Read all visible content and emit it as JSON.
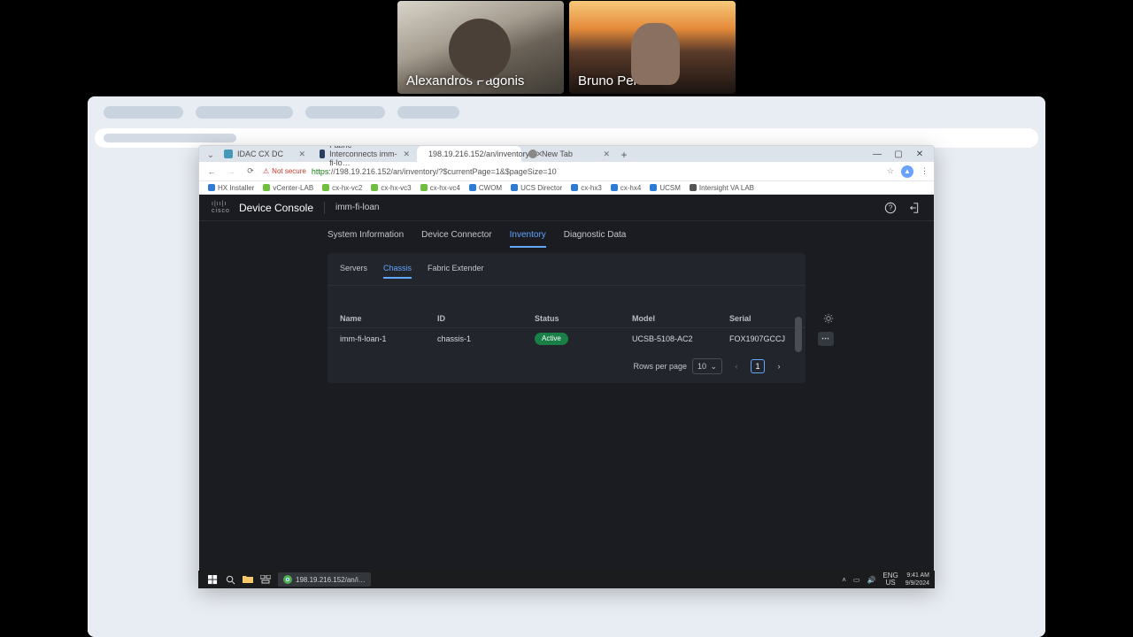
{
  "video": {
    "p1_name": "Alexandros Pagonis",
    "p2_name": "Bruno Pereira"
  },
  "outer_tabs": [
    "",
    "",
    "",
    ""
  ],
  "chrome": {
    "tabs": [
      {
        "label": "IDAC CX DC",
        "active": false
      },
      {
        "label": "Fabric Interconnects imm-fi-lo…",
        "active": false
      },
      {
        "label": "198.19.216.152/an/inventory/",
        "active": true
      },
      {
        "label": "New Tab",
        "active": false
      }
    ],
    "notsecure": "Not secure",
    "url_scheme": "https",
    "url_rest": "://198.19.216.152/an/inventory/?$currentPage=1&$pageSize=10"
  },
  "bookmarks": [
    {
      "c": "#2e7bd6",
      "t": "HX Installer"
    },
    {
      "c": "#6fbf3f",
      "t": "vCenter-LAB"
    },
    {
      "c": "#6fbf3f",
      "t": "cx-hx-vc2"
    },
    {
      "c": "#6fbf3f",
      "t": "cx-hx-vc3"
    },
    {
      "c": "#6fbf3f",
      "t": "cx-hx-vc4"
    },
    {
      "c": "#2e7bd6",
      "t": "CWOM"
    },
    {
      "c": "#2e7bd6",
      "t": "UCS Director"
    },
    {
      "c": "#2e7bd6",
      "t": "cx-hx3"
    },
    {
      "c": "#2e7bd6",
      "t": "cx-hx4"
    },
    {
      "c": "#2e7bd6",
      "t": "UCSM"
    },
    {
      "c": "#555",
      "t": "Intersight VA LAB"
    }
  ],
  "app": {
    "brand_top": "ı|ıı|ı",
    "brand_bot": "cisco",
    "title": "Device Console",
    "device": "imm-fi-loan",
    "nav": [
      "System Information",
      "Device Connector",
      "Inventory",
      "Diagnostic Data"
    ],
    "nav_active": 2,
    "subtabs": [
      "Servers",
      "Chassis",
      "Fabric Extender"
    ],
    "sub_active": 1,
    "cols": [
      "Name",
      "ID",
      "Status",
      "Model",
      "Serial"
    ],
    "rows": [
      {
        "name": "imm-fi-loan-1",
        "id": "chassis-1",
        "status": "Active",
        "model": "UCSB-5108-AC2",
        "serial": "FOX1907GCCJ"
      }
    ],
    "rpp_label": "Rows per page",
    "rpp_value": "10",
    "page": "1"
  },
  "taskbar": {
    "running": "198.19.216.152/an/i…",
    "lang_top": "ENG",
    "lang_bot": "US",
    "time": "9:41 AM",
    "date": "9/9/2024"
  }
}
